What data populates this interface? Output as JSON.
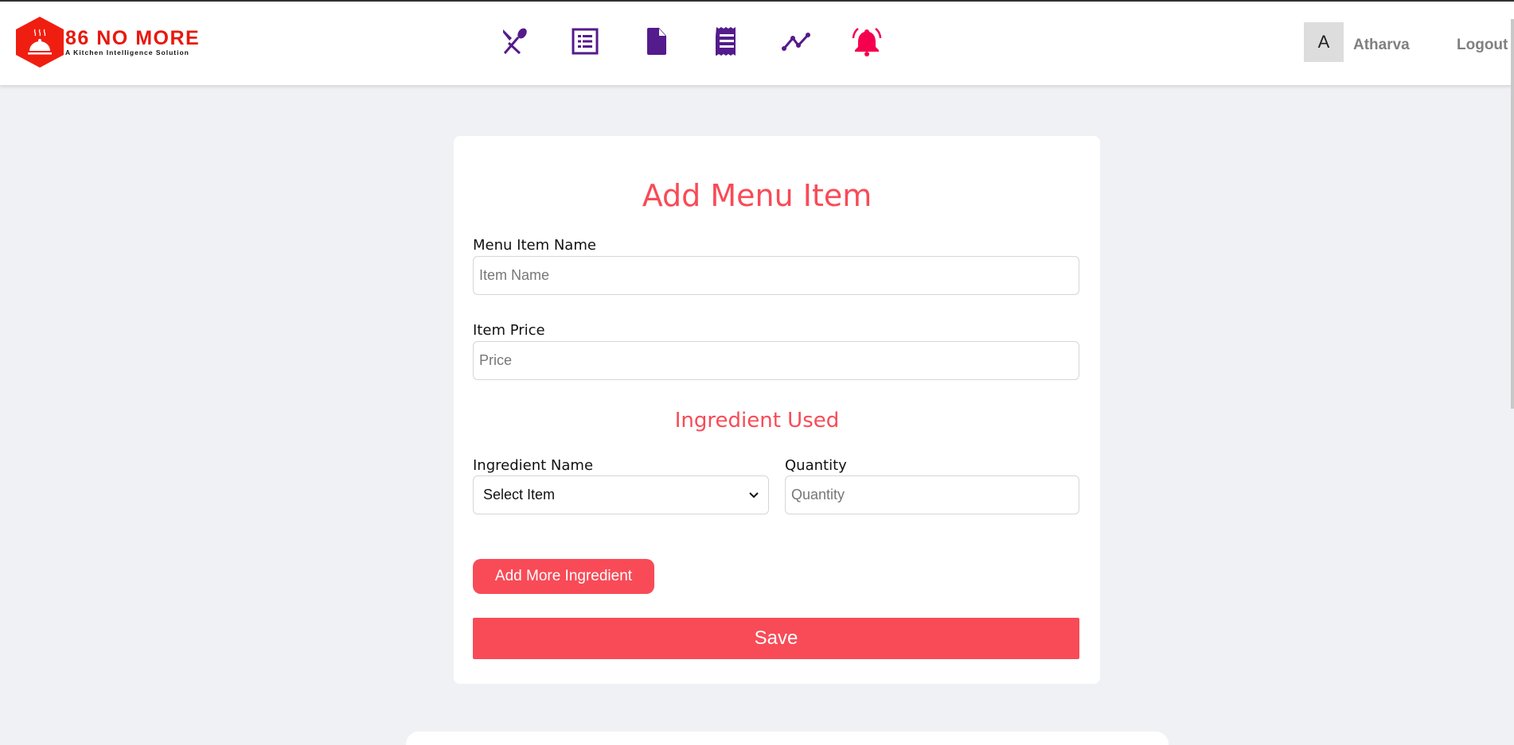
{
  "header": {
    "brand": "86 NO MORE",
    "tagline": "A Kitchen Intelligence Solution",
    "nav_icons": [
      "utensils-icon",
      "list-icon",
      "file-icon",
      "receipt-icon",
      "chart-line-icon",
      "bell-icon"
    ],
    "user_initial": "A",
    "user_name": "Atharva",
    "logout_label": "Logout"
  },
  "form": {
    "title": "Add Menu Item",
    "name_label": "Menu Item Name",
    "name_placeholder": "Item Name",
    "price_label": "Item Price",
    "price_placeholder": "Price",
    "ingredients_heading": "Ingredient Used",
    "ingredient_label": "Ingredient Name",
    "ingredient_selected": "Select Item",
    "quantity_label": "Quantity",
    "quantity_placeholder": "Quantity",
    "add_more_label": "Add More Ingredient",
    "save_label": "Save"
  },
  "colors": {
    "accent": "#f84b57",
    "nav": "#541b8c",
    "bell": "#f5004f",
    "brand": "#e8180c"
  }
}
